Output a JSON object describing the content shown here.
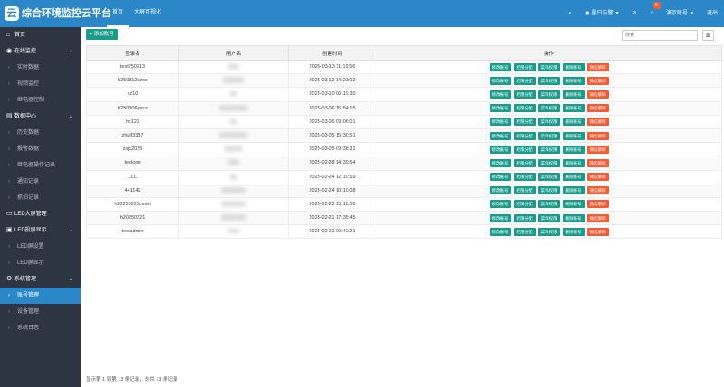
{
  "app": {
    "logo_glyph": "云",
    "title": "综合环境监控云平台"
  },
  "topnav": [
    {
      "label": "首页"
    },
    {
      "label": "大屏可视化"
    }
  ],
  "topright": {
    "theme_icon": "palette-icon",
    "schedule_label": "星日告警",
    "alarm_off_icon": "alarm-off-icon",
    "bell_badge": "5",
    "user_label": "演示账号",
    "logout_label": "退出"
  },
  "sidebar": [
    {
      "type": "top",
      "icon": "⌂",
      "label": "首页"
    },
    {
      "type": "top",
      "icon": "◉",
      "label": "在线监控",
      "arrow": "▲"
    },
    {
      "type": "sub",
      "label": "实时数据"
    },
    {
      "type": "sub",
      "label": "视频监控"
    },
    {
      "type": "sub",
      "label": "继电器控制"
    },
    {
      "type": "top",
      "icon": "▤",
      "label": "数据中心",
      "arrow": "▲"
    },
    {
      "type": "sub",
      "label": "历史数据"
    },
    {
      "type": "sub",
      "label": "报警数据"
    },
    {
      "type": "sub",
      "label": "继电器操作记录"
    },
    {
      "type": "sub",
      "label": "通知记录"
    },
    {
      "type": "sub",
      "label": "抓拍记录"
    },
    {
      "type": "top",
      "icon": "▭",
      "label": "LED大屏管理"
    },
    {
      "type": "top",
      "icon": "▣",
      "label": "LED投屏显示",
      "arrow": "▲"
    },
    {
      "type": "sub",
      "label": "LED屏设置"
    },
    {
      "type": "sub",
      "label": "LED屏显示"
    },
    {
      "type": "top",
      "icon": "⚙",
      "label": "系统管理",
      "arrow": "▲"
    },
    {
      "type": "sub",
      "label": "账号管理",
      "active": true
    },
    {
      "type": "sub",
      "label": "设备管理"
    },
    {
      "type": "sub",
      "label": "系统日志"
    }
  ],
  "toolbar": {
    "add_label": "+ 添加账号",
    "search_placeholder": "搜索",
    "columns_icon": "▥"
  },
  "table": {
    "headers": [
      "登录名",
      "用户名",
      "创建时间",
      "操作"
    ],
    "actions": [
      {
        "label": "修改账号",
        "color": "#1a9b8b"
      },
      {
        "label": "权限分配",
        "color": "#1a9b8b"
      },
      {
        "label": "菜单权限",
        "color": "#1a9b8b"
      },
      {
        "label": "删除账号",
        "color": "#1a9b8b"
      },
      {
        "label": "微信解绑",
        "color": "#f45c36"
      }
    ],
    "rows": [
      {
        "login": "test250313",
        "user": "▒▒▒",
        "created": "2025-03-13 11:19:56"
      },
      {
        "login": "h250312szce",
        "user": "▒▒▒▒▒▒",
        "created": "2025-03-12 14:23:02"
      },
      {
        "login": "xz10",
        "user": "▒▒",
        "created": "2025-03-10 06:19:30"
      },
      {
        "login": "h250306qxcs",
        "user": "▒▒▒▒▒▒▒▒",
        "created": "2025-03-06 15:54:15"
      },
      {
        "login": "hc123",
        "user": "▒▒",
        "created": "2025-03-06 09:06:01"
      },
      {
        "login": "zhuif3387",
        "user": "▒▒▒▒▒▒▒▒",
        "created": "2025-03-05 15:30:51"
      },
      {
        "login": "zsjc2025",
        "user": "▒▒▒▒▒",
        "created": "2025-03-05 09:38:31"
      },
      {
        "login": "testone",
        "user": "▒▒▒",
        "created": "2025-02-28 14:39:54"
      },
      {
        "login": "LLL",
        "user": "▒▒",
        "created": "2025-02-24 12:10:59"
      },
      {
        "login": "441141",
        "user": "▒▒▒▒▒▒▒",
        "created": "2025-02-24 10:10:08"
      },
      {
        "login": "h20250223ceshi",
        "user": "▒▒▒▒▒▒▒",
        "created": "2025-02-23 13:16:56"
      },
      {
        "login": "h20250221",
        "user": "▒▒▒▒▒▒▒",
        "created": "2025-02-21 17:35:45"
      },
      {
        "login": "testadmin",
        "user": "tes▒",
        "created": "2025-02-21 09:42:21"
      }
    ]
  },
  "footer": "显示第 1 到第 13 条记录，总共 13 条记录"
}
